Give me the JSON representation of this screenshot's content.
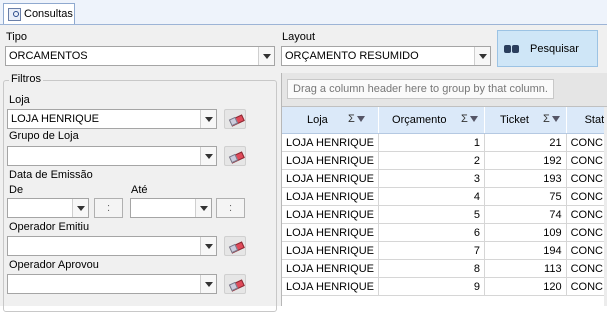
{
  "tab": {
    "label": "Consultas"
  },
  "form": {
    "tipo_label": "Tipo",
    "tipo_value": "ORCAMENTOS",
    "layout_label": "Layout",
    "layout_value": "ORÇAMENTO RESUMIDO",
    "search_label": "Pesquisar",
    "filters_title": "Filtros",
    "loja_label": "Loja",
    "loja_value": "LOJA HENRIQUE",
    "grupo_label": "Grupo de Loja",
    "grupo_value": "",
    "data_label": "Data de Emissão",
    "de_label": "De",
    "ate_label": "Até",
    "time_sep": ":",
    "op_emitiu_label": "Operador Emitiu",
    "op_aprovou_label": "Operador Aprovou"
  },
  "grid": {
    "group_hint": "Drag a column header here to group by that column.",
    "columns": [
      "Loja",
      "Orçamento",
      "Ticket",
      "Stat"
    ],
    "sum_icon": "Σ",
    "rows": [
      {
        "loja": "LOJA HENRIQUE",
        "orcamento": "1",
        "ticket": "21",
        "status": "CONC"
      },
      {
        "loja": "LOJA HENRIQUE",
        "orcamento": "2",
        "ticket": "192",
        "status": "CONC"
      },
      {
        "loja": "LOJA HENRIQUE",
        "orcamento": "3",
        "ticket": "193",
        "status": "CONC"
      },
      {
        "loja": "LOJA HENRIQUE",
        "orcamento": "4",
        "ticket": "75",
        "status": "CONC"
      },
      {
        "loja": "LOJA HENRIQUE",
        "orcamento": "5",
        "ticket": "74",
        "status": "CONC"
      },
      {
        "loja": "LOJA HENRIQUE",
        "orcamento": "6",
        "ticket": "109",
        "status": "CONC"
      },
      {
        "loja": "LOJA HENRIQUE",
        "orcamento": "7",
        "ticket": "194",
        "status": "CONC"
      },
      {
        "loja": "LOJA HENRIQUE",
        "orcamento": "8",
        "ticket": "113",
        "status": "CONC"
      },
      {
        "loja": "LOJA HENRIQUE",
        "orcamento": "9",
        "ticket": "120",
        "status": "CONC"
      }
    ]
  }
}
